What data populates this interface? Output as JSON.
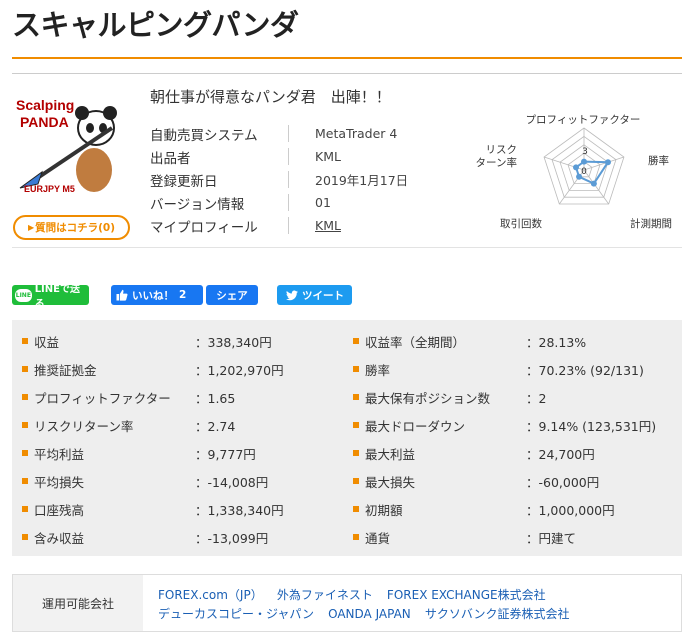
{
  "page": {
    "title": "スキャルピングパンダ"
  },
  "logo": {
    "line1": "Scalping",
    "line2": "PANDA",
    "line3": "EURJPY M5"
  },
  "ask_button": {
    "label": "質問はコチラ(0)"
  },
  "catchphrase": "朝仕事が得意なパンダ君　出陣！！",
  "properties": [
    {
      "label": "自動売買システム",
      "value": "MetaTrader 4"
    },
    {
      "label": "出品者",
      "value": "KML"
    },
    {
      "label": "登録更新日",
      "value": "2019年1月17日"
    },
    {
      "label": "バージョン情報",
      "value": "01"
    },
    {
      "label": "マイプロフィール",
      "value": "KML"
    }
  ],
  "radar": {
    "axes": [
      "プロフィットファクター",
      "勝率",
      "計測期間",
      "取引回数",
      "リスクリターン率"
    ],
    "axis_label_risk_line1": "リスク",
    "axis_label_risk_line2": "ターン率",
    "scale_label_top": "3",
    "scale_label_center": "0",
    "values": [
      1,
      3,
      2,
      1,
      1
    ],
    "max": 5,
    "colors": {
      "grid": "#bbbbbb",
      "series": "#5b9bd5"
    }
  },
  "share": {
    "line_icon": "LINE",
    "line_label": "LINEで送る",
    "fb_like_label": "いいね！",
    "fb_like_count": "2",
    "fb_share_label": "シェア",
    "tweet_label": "ツイート"
  },
  "stats_left": [
    {
      "label": "収益",
      "value": "：338,340円"
    },
    {
      "label": "推奨証拠金",
      "value": "：1,202,970円"
    },
    {
      "label": "プロフィットファクター",
      "value": "：1.65"
    },
    {
      "label": "リスクリターン率",
      "value": "：2.74"
    },
    {
      "label": "平均利益",
      "value": "：9,777円"
    },
    {
      "label": "平均損失",
      "value": "：-14,008円"
    },
    {
      "label": "口座残高",
      "value": "：1,338,340円"
    },
    {
      "label": "含み収益",
      "value": "：-13,099円"
    }
  ],
  "stats_right": [
    {
      "label": "収益率（全期間）",
      "value": "：28.13%"
    },
    {
      "label": "勝率",
      "value": "：70.23% (92/131)"
    },
    {
      "label": "最大保有ポジション数",
      "value": "：2"
    },
    {
      "label": "最大ドローダウン",
      "value": "：9.14% (123,531円)"
    },
    {
      "label": "最大利益",
      "value": "：24,700円"
    },
    {
      "label": "最大損失",
      "value": "：-60,000円"
    },
    {
      "label": "初期額",
      "value": "：1,000,000円"
    },
    {
      "label": "通貨",
      "value": "：円建て"
    }
  ],
  "brokers": {
    "label": "運用可能会社",
    "items": [
      "FOREX.com（JP）",
      "外為ファイネスト",
      "FOREX EXCHANGE株式会社",
      "デューカスコピー・ジャパン",
      "OANDA JAPAN",
      "サクソバンク証券株式会社"
    ]
  },
  "colors": {
    "accent": "#f08c00",
    "line_green": "#1fbd3a",
    "facebook": "#1877f2",
    "twitter": "#1d9bf0",
    "link": "#1a5fb4"
  }
}
